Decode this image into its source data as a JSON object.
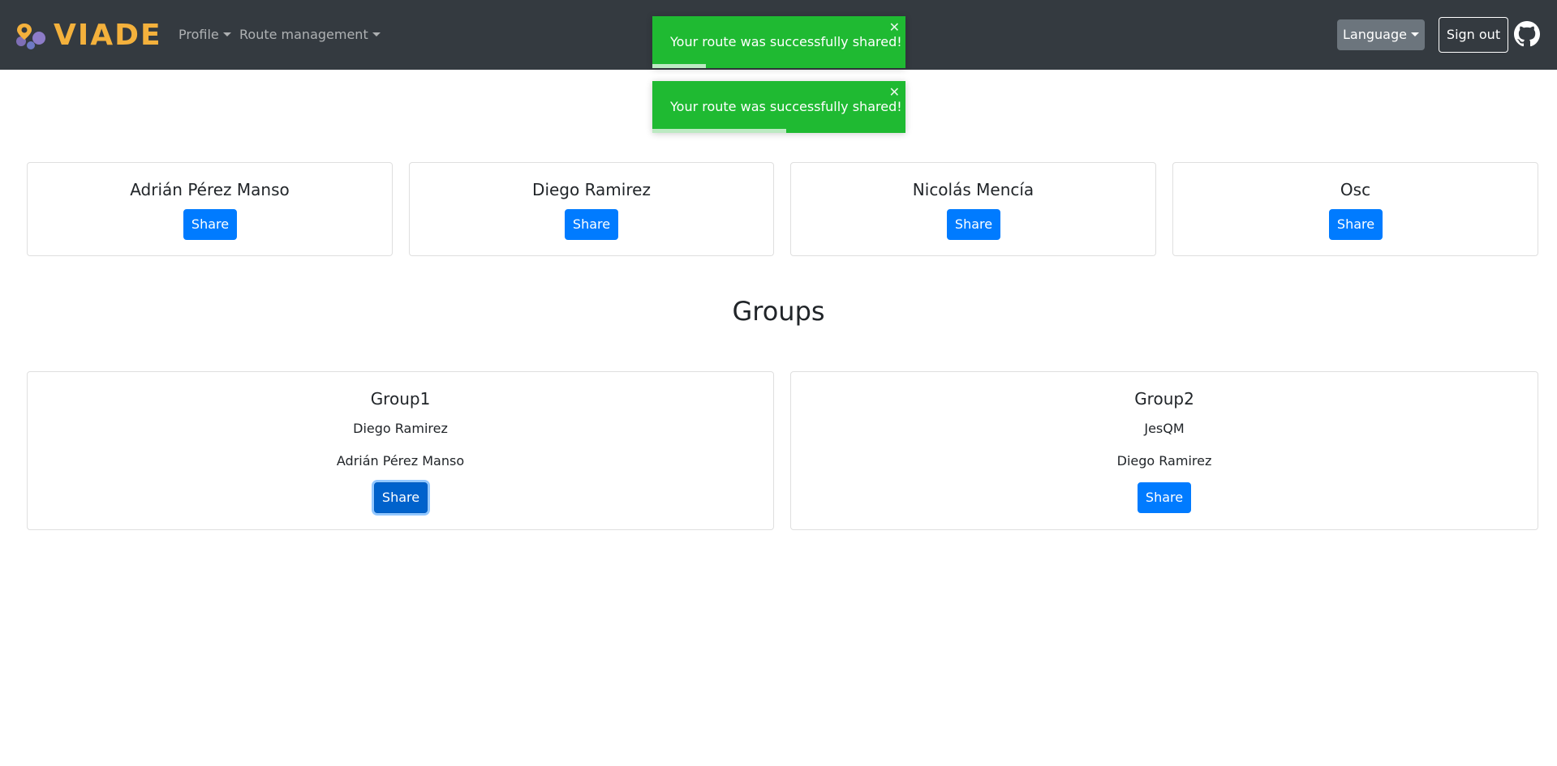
{
  "brand": {
    "name": "VIADE",
    "accent": "#f4b13c"
  },
  "nav": {
    "profile_label": "Profile",
    "route_management_label": "Route management",
    "language_label": "Language",
    "signout_label": "Sign out"
  },
  "toasts": [
    {
      "message": "Your route was successfully shared!",
      "close": "✕",
      "progress": 0.21
    },
    {
      "message": "Your route was successfully shared!",
      "close": "✕",
      "progress": 0.53
    }
  ],
  "friends": [
    {
      "name": "Adrián Pérez Manso",
      "share_label": "Share"
    },
    {
      "name": "Diego Ramirez",
      "share_label": "Share"
    },
    {
      "name": "Nicolás Mencía",
      "share_label": "Share"
    },
    {
      "name": "Osc",
      "share_label": "Share"
    }
  ],
  "groups_heading": "Groups",
  "groups": [
    {
      "name": "Group1",
      "members": [
        "Diego Ramirez",
        "Adrián Pérez Manso"
      ],
      "share_label": "Share"
    },
    {
      "name": "Group2",
      "members": [
        "JesQM",
        "Diego Ramirez"
      ],
      "share_label": "Share"
    }
  ],
  "colors": {
    "navbar": "#343a40",
    "primary": "#007bff",
    "toast": "#1fba32",
    "secondary": "#6c757d"
  }
}
